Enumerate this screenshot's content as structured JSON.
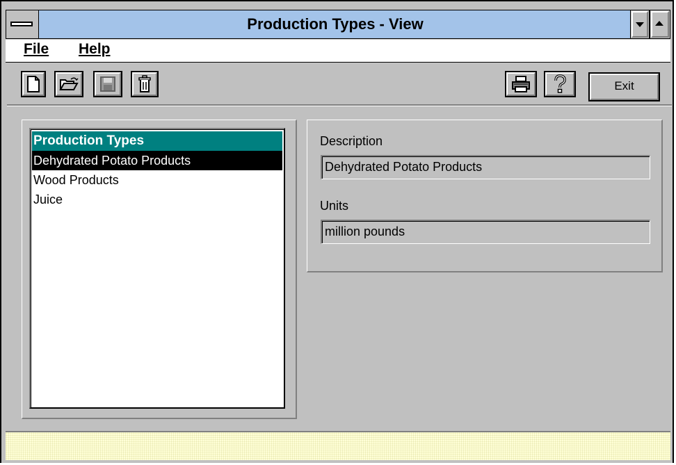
{
  "window": {
    "title": "Production Types - View"
  },
  "menu": {
    "items": [
      {
        "label": "File"
      },
      {
        "label": "Help"
      }
    ]
  },
  "toolbar": {
    "buttons": [
      {
        "icon": "new-document-icon"
      },
      {
        "icon": "open-folder-icon"
      },
      {
        "icon": "save-disk-icon"
      },
      {
        "icon": "trash-icon"
      },
      {
        "icon": "printer-icon"
      },
      {
        "icon": "help-question-icon"
      }
    ],
    "exit_label": "Exit"
  },
  "list": {
    "header": "Production Types",
    "items": [
      {
        "label": "Dehydrated Potato Products",
        "selected": true
      },
      {
        "label": "Wood Products",
        "selected": false
      },
      {
        "label": "Juice",
        "selected": false
      }
    ]
  },
  "detail": {
    "description_label": "Description",
    "description_value": "Dehydrated Potato Products",
    "units_label": "Units",
    "units_value": "million pounds"
  },
  "colors": {
    "title_bar": "#a3c3e9",
    "list_header": "#008080",
    "selection": "#000000",
    "status_bar": "#ffffd8"
  }
}
